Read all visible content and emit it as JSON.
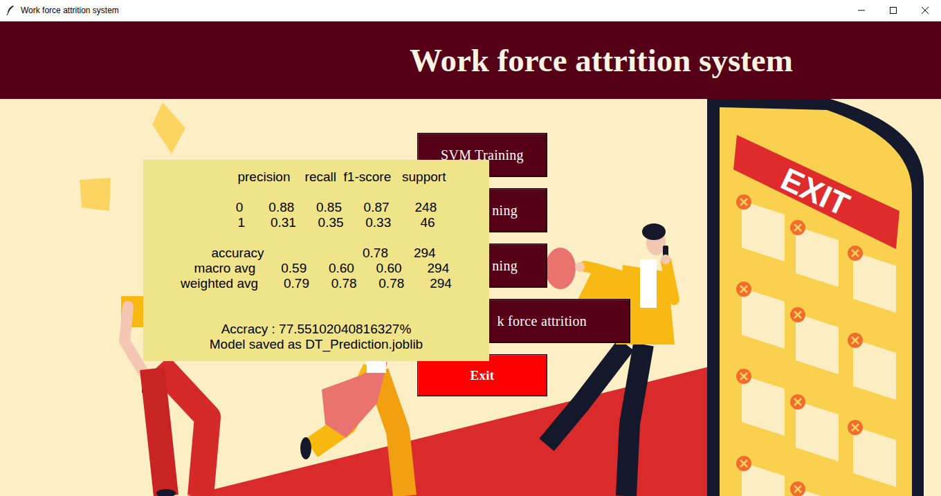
{
  "window": {
    "title": "Work force attrition system"
  },
  "header": {
    "title": "Work force attrition system"
  },
  "buttons": [
    {
      "label": "SVM Training",
      "kind": "menu"
    },
    {
      "label": "ning",
      "kind": "menu"
    },
    {
      "label": "ning",
      "kind": "menu"
    },
    {
      "label": "k force attrition",
      "kind": "menu"
    },
    {
      "label": "Exit",
      "kind": "exit"
    }
  ],
  "illustration": {
    "sign": "EXIT"
  },
  "report": {
    "header": "              precision    recall  f1-score   support",
    "classes": [
      "           0       0.88      0.85      0.87       248",
      "           1       0.31      0.35      0.33        46"
    ],
    "averages": [
      "    accuracy                           0.78       294",
      "   macro avg       0.59      0.60      0.60       294",
      "weighted avg       0.79      0.78      0.78       294"
    ]
  },
  "summary": [
    "Accracy : 77.55102040816327%",
    "Model saved as DT_Prediction.joblib"
  ]
}
